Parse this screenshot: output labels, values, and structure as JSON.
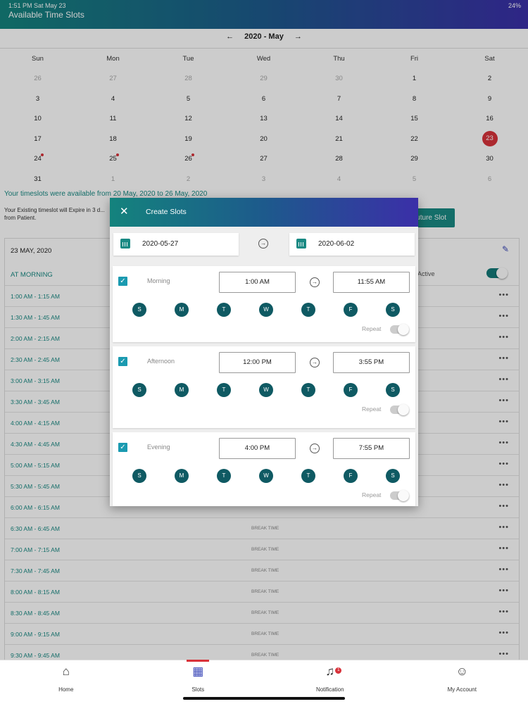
{
  "status": {
    "time": "1:51 PM  Sat May 23",
    "battery": "24%"
  },
  "app": {
    "title": "Available Time Slots"
  },
  "calendar": {
    "month_label": "2020 - May",
    "weekdays": [
      "Sun",
      "Mon",
      "Tue",
      "Wed",
      "Thu",
      "Fri",
      "Sat"
    ],
    "weeks": [
      [
        "26",
        "27",
        "28",
        "29",
        "30",
        "1",
        "2"
      ],
      [
        "3",
        "4",
        "5",
        "6",
        "7",
        "8",
        "9"
      ],
      [
        "10",
        "11",
        "12",
        "13",
        "14",
        "15",
        "16"
      ],
      [
        "17",
        "18",
        "19",
        "20",
        "21",
        "22",
        "23"
      ],
      [
        "24",
        "25",
        "26",
        "27",
        "28",
        "29",
        "30"
      ],
      [
        "31",
        "1",
        "2",
        "3",
        "4",
        "5",
        "6"
      ]
    ]
  },
  "availability_text": "Your timeslots were available from 20 May, 2020 to 26 May, 2020",
  "expire_text": "Your Existing timeslot will Expire in 3 d... from Patient.",
  "future_slot_label": "Future Slot",
  "slots_panel": {
    "date": "23 MAY, 2020",
    "section": "AT MORNING",
    "active_label": "Active",
    "rows": [
      {
        "time": "1:00 AM - 1:15 AM",
        "note": ""
      },
      {
        "time": "1:30 AM - 1:45 AM",
        "note": ""
      },
      {
        "time": "2:00 AM - 2:15 AM",
        "note": ""
      },
      {
        "time": "2:30 AM - 2:45 AM",
        "note": ""
      },
      {
        "time": "3:00 AM - 3:15 AM",
        "note": ""
      },
      {
        "time": "3:30 AM - 3:45 AM",
        "note": ""
      },
      {
        "time": "4:00 AM - 4:15 AM",
        "note": ""
      },
      {
        "time": "4:30 AM - 4:45 AM",
        "note": ""
      },
      {
        "time": "5:00 AM - 5:15 AM",
        "note": ""
      },
      {
        "time": "5:30 AM - 5:45 AM",
        "note": ""
      },
      {
        "time": "6:00 AM - 6:15 AM",
        "note": ""
      },
      {
        "time": "6:30 AM - 6:45 AM",
        "note": "BREAK TIME"
      },
      {
        "time": "7:00 AM - 7:15 AM",
        "note": "BREAK TIME"
      },
      {
        "time": "7:30 AM - 7:45 AM",
        "note": "BREAK TIME"
      },
      {
        "time": "8:00 AM - 8:15 AM",
        "note": "BREAK TIME"
      },
      {
        "time": "8:30 AM - 8:45 AM",
        "note": "BREAK TIME"
      },
      {
        "time": "9:00 AM - 9:15 AM",
        "note": "BREAK TIME"
      },
      {
        "time": "9:30 AM - 9:45 AM",
        "note": "BREAK TIME"
      }
    ],
    "more_glyph": "•••"
  },
  "nav": {
    "items": [
      {
        "label": "Home",
        "icon": "home-icon"
      },
      {
        "label": "Slots",
        "icon": "calendar-icon"
      },
      {
        "label": "Notification",
        "icon": "bell-icon",
        "badge": "1"
      },
      {
        "label": "My Account",
        "icon": "user-icon"
      }
    ]
  },
  "modal": {
    "title": "Create Slots",
    "start_date": "2020-05-27",
    "end_date": "2020-06-02",
    "day_letters": [
      "S",
      "M",
      "T",
      "W",
      "T",
      "F",
      "S"
    ],
    "repeat_label": "Repeat",
    "periods": [
      {
        "name": "Morning",
        "from": "1:00 AM",
        "to": "11:55 AM"
      },
      {
        "name": "Afternoon",
        "from": "12:00 PM",
        "to": "3:55 PM"
      },
      {
        "name": "Evening",
        "from": "4:00 PM",
        "to": "7:55 PM"
      }
    ]
  },
  "colors": {
    "accent": "#1a8a84",
    "today": "#d8323a",
    "day_circle": "#0f5a63"
  }
}
